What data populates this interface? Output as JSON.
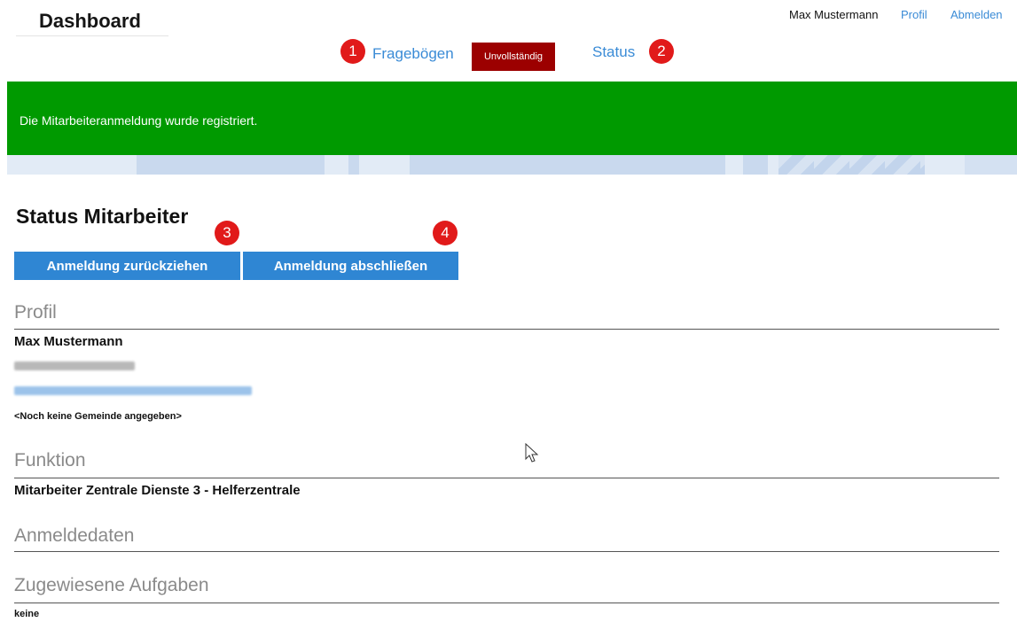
{
  "header": {
    "title": "Dashboard",
    "user_name": "Max Mustermann",
    "profile_link": "Profil",
    "logout_link": "Abmelden"
  },
  "nav": {
    "questionnaires": {
      "marker": "1",
      "label": "Fragebögen",
      "badge": "Unvollständig"
    },
    "status": {
      "marker": "2",
      "label": "Status"
    }
  },
  "banner": {
    "message": "Die Mitarbeiteranmeldung wurde registriert."
  },
  "page": {
    "title": "Status Mitarbeiter"
  },
  "actions": {
    "withdraw": {
      "marker": "3",
      "label": "Anmeldung zurückziehen"
    },
    "complete": {
      "marker": "4",
      "label": "Anmeldung abschließen"
    }
  },
  "profile": {
    "heading": "Profil",
    "name": "Max Mustermann",
    "no_community": "<Noch keine Gemeinde angegeben>"
  },
  "function": {
    "heading": "Funktion",
    "value": "Mitarbeiter Zentrale Dienste 3 - Helferzentrale"
  },
  "registration_data": {
    "heading": "Anmeldedaten"
  },
  "tasks": {
    "heading": "Zugewiesene Aufgaben",
    "value": "keine"
  },
  "colors": {
    "link": "#3a8bd6",
    "marker": "#e11a1a",
    "badge": "#9c0000",
    "success": "#009a00",
    "button": "#2f86d3"
  }
}
